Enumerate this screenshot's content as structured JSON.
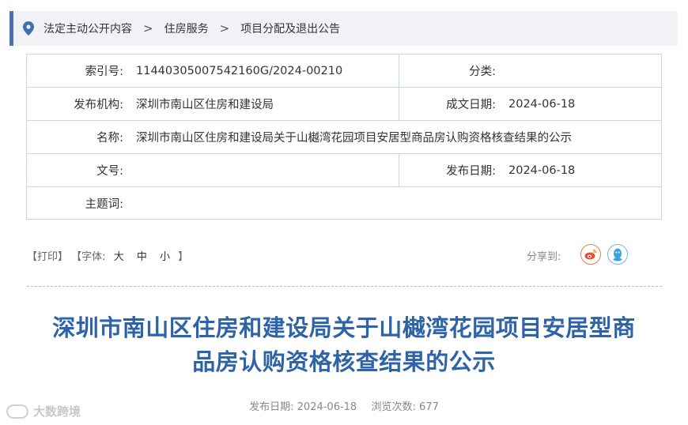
{
  "breadcrumb": {
    "items": [
      "法定主动公开内容",
      "住房服务",
      "项目分配及退出公告"
    ],
    "separator": ">"
  },
  "meta": {
    "index_label": "索引号:",
    "index_value": "11440305007542160G/2024-00210",
    "category_label": "分类:",
    "category_value": "",
    "publisher_label": "发布机构:",
    "publisher_value": "深圳市南山区住房和建设局",
    "created_label": "成文日期:",
    "created_value": "2024-06-18",
    "name_label": "名称:",
    "name_value": "深圳市南山区住房和建设局关于山樾湾花园项目安居型商品房认购资格核查结果的公示",
    "doc_no_label": "文号:",
    "doc_no_value": "",
    "published_label": "发布日期:",
    "published_value": "2024-06-18",
    "keywords_label": "主题词:",
    "keywords_value": ""
  },
  "tools": {
    "print": "【打印】",
    "font_prefix": "【字体:",
    "font_large": "大",
    "font_medium": "中",
    "font_small": "小",
    "font_suffix": "】"
  },
  "share": {
    "label": "分享到:",
    "icons": [
      "weibo-icon",
      "qq-icon"
    ]
  },
  "article": {
    "title_line1": "深圳市南山区住房和建设局关于山樾湾花园项目安居型商",
    "title_line2": "品房认购资格核查结果的公示",
    "date_label": "发布日期:",
    "date_value": "2024-06-18",
    "views_label": "浏览次数:",
    "views_value": "677"
  },
  "watermark": {
    "text": "大数跨境"
  },
  "colors": {
    "accent": "#4a72b0",
    "title": "#2e63a8",
    "border": "#c9d8e8",
    "breadcrumb_bg": "#f0f2f5",
    "weibo": "#e6502c",
    "qq": "#3fa0e0"
  }
}
